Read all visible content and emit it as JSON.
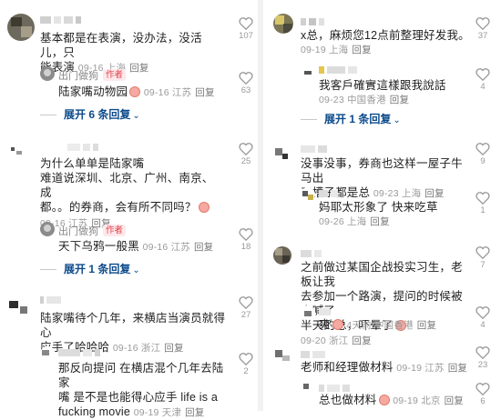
{
  "left": {
    "c1": {
      "username": "▁▂▃▁",
      "text_l1": "基本都是在表演，没办法，没活儿，只",
      "text_l2": "能表演",
      "time": "09-16",
      "loc": "上海",
      "reply": "回复",
      "likes": "107",
      "sub": {
        "author": "出门做狗",
        "badge": "作者",
        "text": "陆家嘴动物园",
        "time": "09-16",
        "loc": "江苏",
        "reply": "回复",
        "likes": "63"
      },
      "expand": "展开 6 条回复"
    },
    "c2": {
      "text_l1": "为什么单单是陆家嘴",
      "text_l2": "难道说深圳、北京、广州、南京、成",
      "text_l3": "都。。的券商，会有所不同吗？",
      "time": "09-16",
      "loc": "江苏",
      "reply": "回复",
      "likes": "25",
      "sub": {
        "author": "出门做狗",
        "badge": "作者",
        "text": "天下乌鸦一般黑",
        "time": "09-16",
        "loc": "江苏",
        "reply": "回复",
        "likes": "18"
      },
      "expand": "展开 1 条回复"
    },
    "c3": {
      "text_l1": "陆家嘴待个几年，来横店当演员就得心",
      "text_l2": "应手了哈哈哈",
      "time": "09-16",
      "loc": "浙江",
      "reply": "回复",
      "likes": "27",
      "sub": {
        "text_l1": "那反向提问 在横店混个几年去陆家",
        "text_l2": "嘴 是不是也能得心应手 life is a",
        "text_l3": "fucking movie",
        "time": "09-19",
        "loc": "天津",
        "reply": "回复",
        "likes": "2"
      }
    }
  },
  "right": {
    "c1": {
      "text": "x总，麻烦您12点前整理好发我。",
      "time": "09-19",
      "loc": "上海",
      "reply": "回复",
      "likes": "37",
      "sub": {
        "text": "我客戶確實這樣跟我說話",
        "time": "09-23",
        "loc": "中国香港",
        "reply": "回复",
        "likes": "4"
      },
      "expand": "展开 1 条回复"
    },
    "c2": {
      "text_l1": "没事没事，券商也这样",
      "text_l1b": "一屋子牛马出",
      "text_l2": "了槽子都是总",
      "time": "09-23",
      "loc": "上海",
      "reply": "回复",
      "likes": "9",
      "sub": {
        "text": "妈耶太形象了 快来吃草",
        "time": "09-26",
        "loc": "上海",
        "reply": "回复",
        "likes": "1"
      }
    },
    "c3": {
      "text_l1": "之前做过某国企战投实习生，老板让我",
      "text_l2": "去参加一个路演，提问的时候被人喊了",
      "text_l3": "半天的总，吓晕了",
      "time": "09-20",
      "loc": "浙江",
      "reply": "回复",
      "likes": "7",
      "sub": {
        "text": "爽",
        "time": "4天前",
        "loc": "中国香港",
        "reply": "回复",
        "likes": "4"
      }
    },
    "c4": {
      "text": "老师和经理做材料",
      "time": "09-19",
      "loc": "江苏",
      "reply": "回复",
      "likes": "23",
      "sub": {
        "text": "总也做材料",
        "time": "09-19",
        "loc": "北京",
        "reply": "回复",
        "likes": "6"
      }
    }
  }
}
